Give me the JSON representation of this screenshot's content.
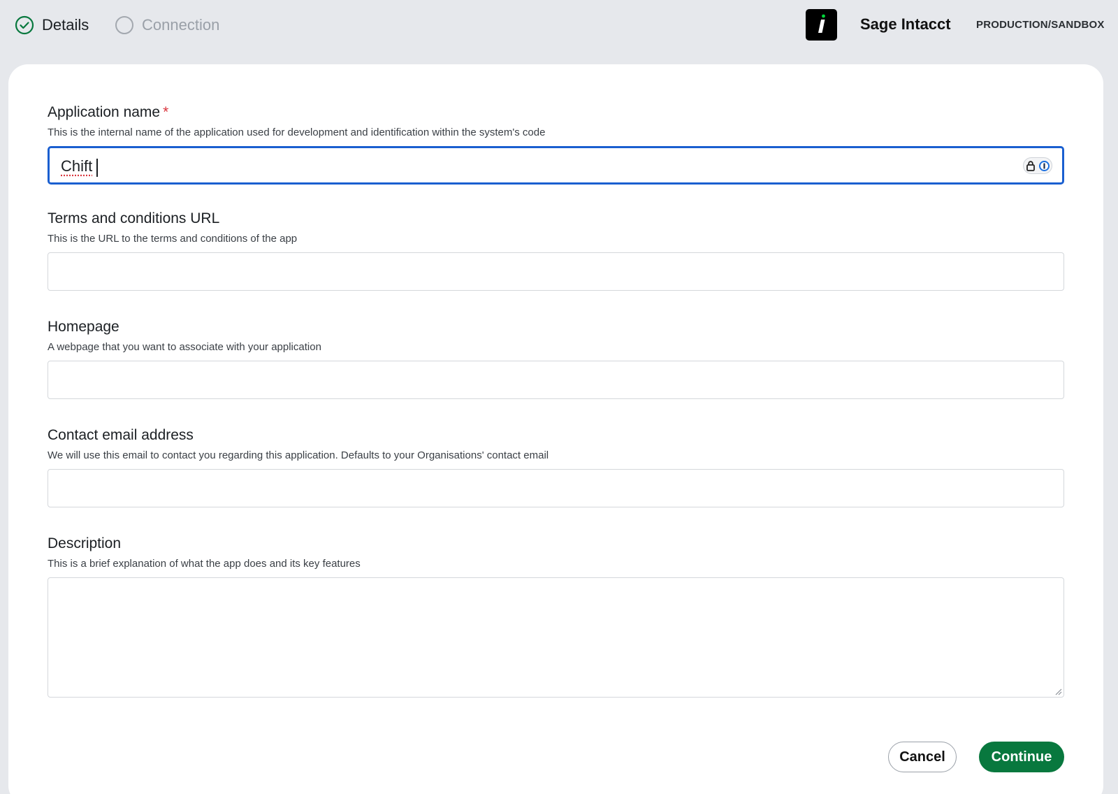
{
  "stepper": {
    "steps": [
      {
        "label": "Details",
        "state": "completed"
      },
      {
        "label": "Connection",
        "state": "pending"
      }
    ]
  },
  "brand": {
    "name": "Sage Intacct",
    "environment": "PRODUCTION/SANDBOX",
    "logo_icon": "sage-intacct-logo-icon"
  },
  "form": {
    "application_name": {
      "label": "Application name",
      "required_marker": "*",
      "help": "This is the internal name of the application used for development and identification within the system's code",
      "value": "Chift"
    },
    "terms_url": {
      "label": "Terms and conditions URL",
      "help": "This is the URL to the terms and conditions of the app",
      "value": ""
    },
    "homepage": {
      "label": "Homepage",
      "help": "A webpage that you want to associate with your application",
      "value": ""
    },
    "contact_email": {
      "label": "Contact email address",
      "help": "We will use this email to contact you regarding this application. Defaults to your Organisations' contact email",
      "value": ""
    },
    "description": {
      "label": "Description",
      "help": "This is a brief explanation of what the app does and its key features",
      "value": ""
    }
  },
  "actions": {
    "cancel_label": "Cancel",
    "continue_label": "Continue"
  },
  "colors": {
    "accent_green": "#08783e",
    "focus_blue": "#1a5fd0",
    "required_red": "#d9363e",
    "page_bg": "#e6e8ec"
  }
}
